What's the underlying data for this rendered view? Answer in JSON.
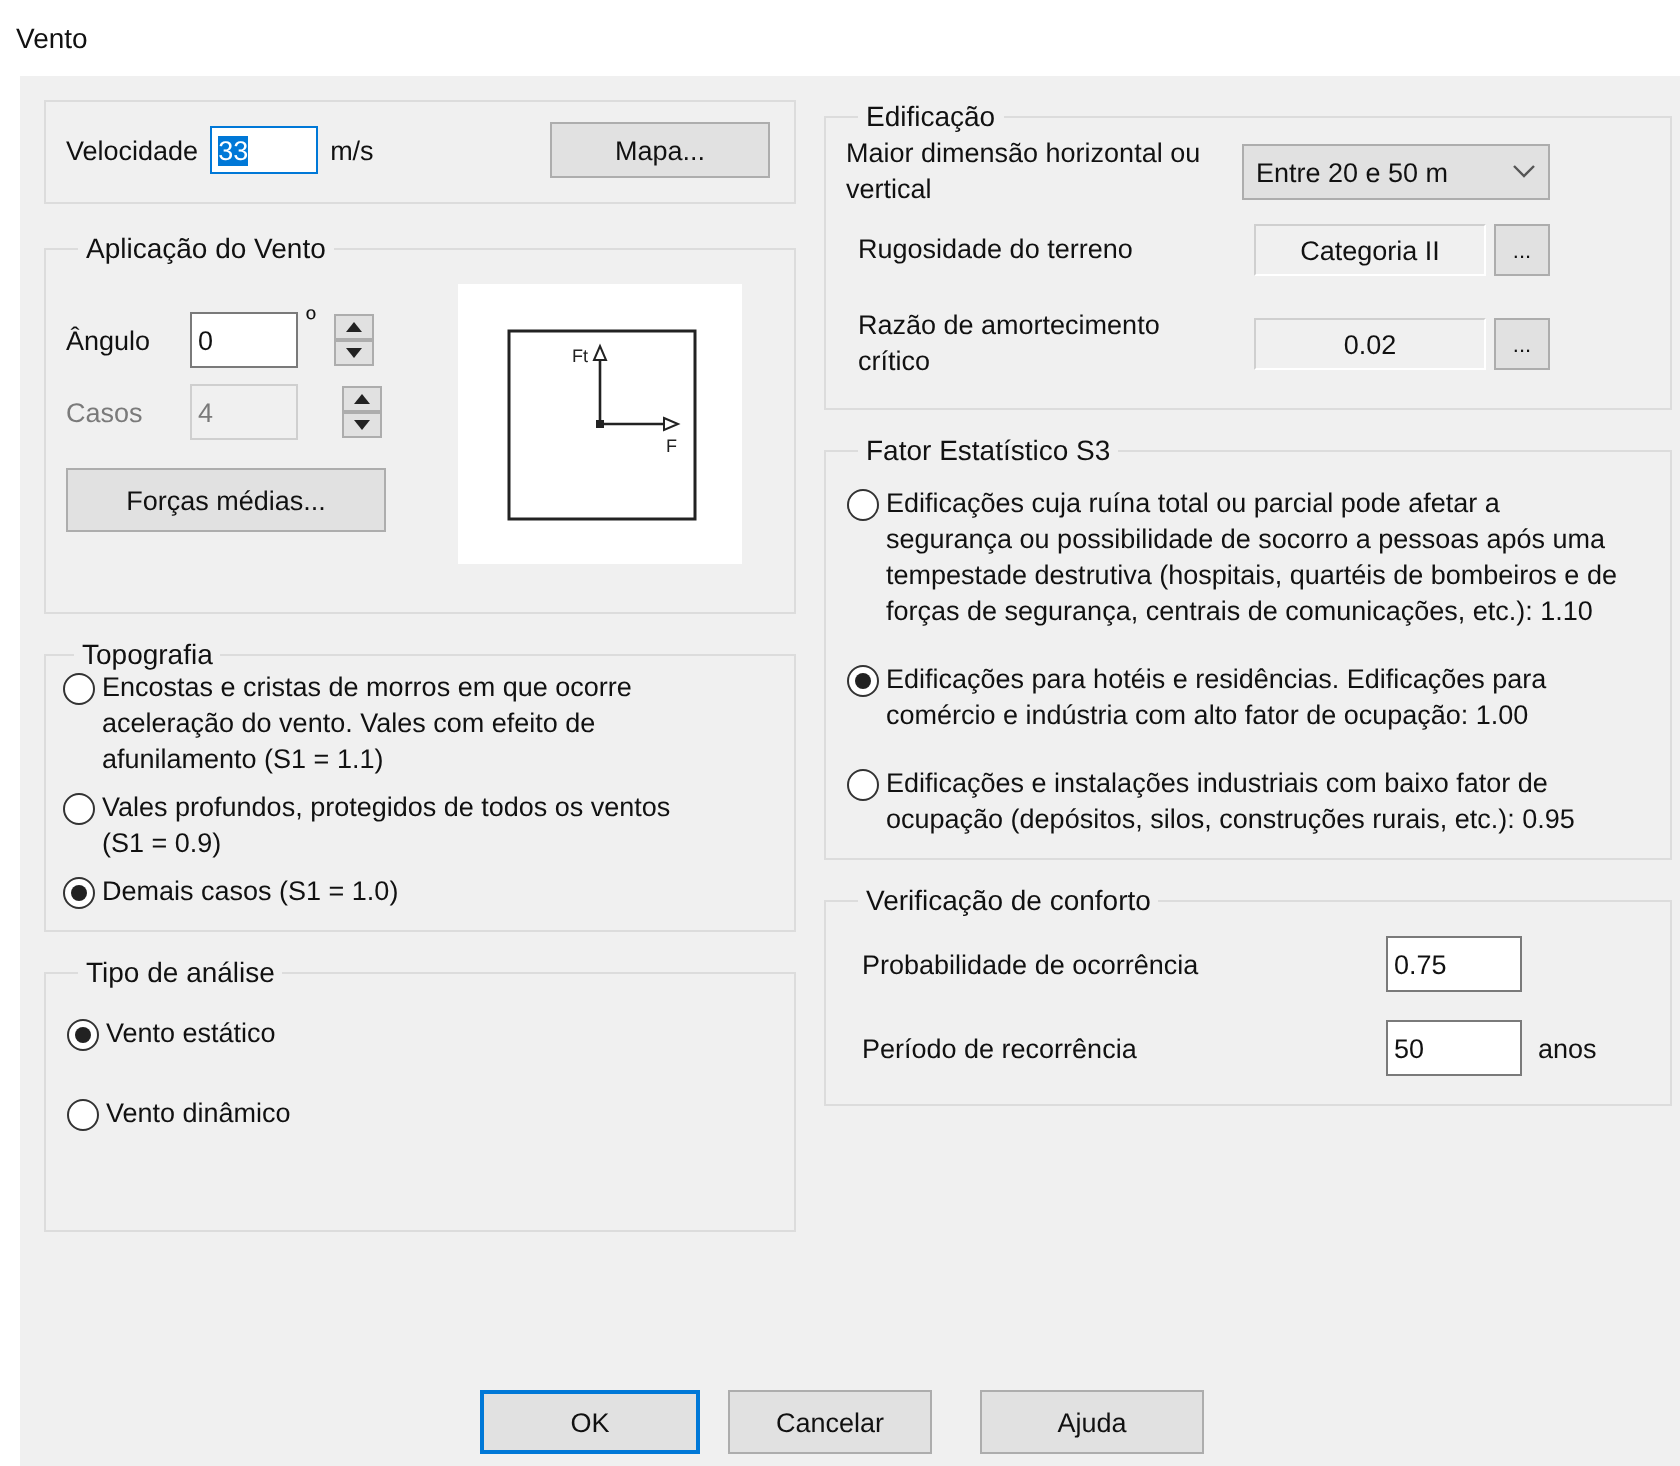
{
  "window": {
    "title": "Vento"
  },
  "velocity": {
    "label": "Velocidade",
    "value": "33",
    "text_selected": true,
    "unit": "m/s",
    "map_button": "Mapa..."
  },
  "wind_application": {
    "title": "Aplicação do Vento",
    "angle": {
      "label": "Ângulo",
      "value": "0",
      "unit": "º",
      "disabled": false
    },
    "cases": {
      "label": "Casos",
      "value": "4",
      "disabled": true
    },
    "mean_forces_button": "Forças médias...",
    "diagram": {
      "labels": [
        "Ft",
        "F"
      ]
    }
  },
  "topography": {
    "title": "Topografia",
    "options": [
      {
        "label": "Encostas e cristas de morros em que ocorre aceleração do vento. Vales com efeito de afunilamento (S1 = 1.1)",
        "selected": false
      },
      {
        "label": "Vales profundos, protegidos de todos os ventos (S1 = 0.9)",
        "selected": false
      },
      {
        "label": "Demais casos (S1 = 1.0)",
        "selected": true
      }
    ]
  },
  "analysis_type": {
    "title": "Tipo de análise",
    "options": [
      {
        "label": "Vento estático",
        "selected": true
      },
      {
        "label": "Vento dinâmico",
        "selected": false
      }
    ]
  },
  "building": {
    "title": "Edificação",
    "rows": [
      {
        "kind": "dropdown",
        "label": "Maior dimensão horizontal ou vertical",
        "value": "Entre 20 e 50 m"
      },
      {
        "kind": "picker",
        "label": "Rugosidade do terreno",
        "value": "Categoria II",
        "button": "..."
      },
      {
        "kind": "picker",
        "label": "Razão de amortecimento crítico",
        "value": "0.02",
        "button": "..."
      }
    ]
  },
  "statistical_factor": {
    "title": "Fator Estatístico S3",
    "options": [
      {
        "label": "Edificações cuja ruína total ou parcial pode afetar a segurança ou possibilidade de socorro a pessoas após uma tempestade destrutiva (hospitais, quartéis de bombeiros e de forças de segurança, centrais de comunicações, etc.): 1.10",
        "selected": false
      },
      {
        "label": "Edificações para hotéis e residências. Edificações para comércio e indústria com alto fator de ocupação: 1.00",
        "selected": true
      },
      {
        "label": "Edificações e instalações industriais com baixo fator de ocupação (depósitos, silos, construções rurais, etc.): 0.95",
        "selected": false
      }
    ]
  },
  "comfort": {
    "title": "Verificação de conforto",
    "rows": [
      {
        "label": "Probabilidade de ocorrência",
        "value": "0.75"
      },
      {
        "label": "Período de recorrência",
        "value": "50",
        "unit": "anos"
      }
    ]
  },
  "buttons": [
    {
      "label": "OK",
      "default": true
    },
    {
      "label": "Cancelar",
      "default": false
    },
    {
      "label": "Ajuda",
      "default": false
    }
  ]
}
